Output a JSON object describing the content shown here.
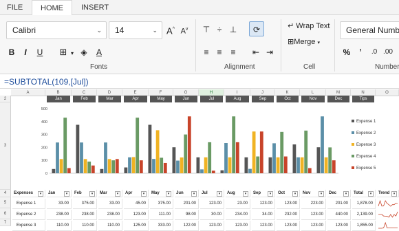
{
  "tabs": [
    "FILE",
    "HOME",
    "INSERT"
  ],
  "active_tab": "HOME",
  "font": {
    "name": "Calibri",
    "size": "14",
    "grow": "A",
    "shrink": "A"
  },
  "groups": {
    "fonts": "Fonts",
    "alignment": "Alignment",
    "cell": "Cell",
    "number": "Number"
  },
  "cell_group": {
    "wrap_text": "Wrap Text",
    "merge": "Merge"
  },
  "number_group": {
    "format": "General Number"
  },
  "formula": "=SUBTOTAL(109,[Jul])",
  "columns": [
    "A",
    "B",
    "C",
    "D",
    "E",
    "F",
    "G",
    "H",
    "I",
    "J",
    "K",
    "L",
    "M",
    "N",
    "O"
  ],
  "selected_column": "H",
  "rows": [
    "2",
    "3",
    "4",
    "5",
    "6",
    "7"
  ],
  "month_headers": [
    "Jan",
    "Feb",
    "Mar",
    "Apr",
    "May",
    "Jun",
    "Jul",
    "Aug",
    "Sep",
    "Oct",
    "Nov",
    "Dec",
    "Tips"
  ],
  "table": {
    "headers": [
      "Expenses",
      "Jan",
      "Feb",
      "Mar",
      "Apr",
      "May",
      "Jun",
      "Jul",
      "Aug",
      "Sep",
      "Oct",
      "Nov",
      "Dec",
      "Total",
      "Trend"
    ],
    "rows": [
      {
        "label": "Expense 1",
        "values": [
          "33.00",
          "375.00",
          "33.00",
          "45.00",
          "375.00",
          "201.00",
          "123.00",
          "23.00",
          "123.00",
          "123.00",
          "223.00",
          "201.00"
        ],
        "total": "1,878.00"
      },
      {
        "label": "Expense 2",
        "values": [
          "238.00",
          "238.00",
          "238.00",
          "123.00",
          "111.00",
          "98.00",
          "30.00",
          "234.00",
          "34.00",
          "232.00",
          "123.00",
          "440.00"
        ],
        "total": "2,139.00"
      },
      {
        "label": "Expense 3",
        "values": [
          "110.00",
          "110.00",
          "110.00",
          "125.00",
          "333.00",
          "122.00",
          "123.00",
          "123.00",
          "123.00",
          "123.00",
          "123.00",
          "123.00"
        ],
        "total": "1,855.00"
      }
    ]
  },
  "chart_data": {
    "type": "bar",
    "categories": [
      "Jan",
      "Feb",
      "Mar",
      "Apr",
      "May",
      "Jun",
      "Jul",
      "Aug",
      "Sep",
      "Oct",
      "Nov",
      "Dec"
    ],
    "ylim": [
      0,
      500
    ],
    "yticks": [
      "0",
      "100",
      "200",
      "300",
      "400",
      "500"
    ],
    "legend_position": "right",
    "series": [
      {
        "name": "Expense 1",
        "color": "#555555",
        "values": [
          33,
          375,
          33,
          45,
          375,
          201,
          123,
          23,
          123,
          123,
          223,
          201
        ]
      },
      {
        "name": "Expense 2",
        "color": "#5b8fa8",
        "values": [
          238,
          238,
          238,
          123,
          111,
          98,
          30,
          234,
          34,
          232,
          123,
          440
        ]
      },
      {
        "name": "Expense 3",
        "color": "#f0b323",
        "values": [
          110,
          110,
          110,
          125,
          333,
          122,
          123,
          123,
          323,
          123,
          123,
          123
        ]
      },
      {
        "name": "Expense 4",
        "color": "#6a9a64",
        "values": [
          430,
          90,
          100,
          430,
          120,
          300,
          240,
          440,
          130,
          320,
          330,
          200
        ]
      },
      {
        "name": "Expense 5",
        "color": "#c8442a",
        "values": [
          40,
          60,
          110,
          100,
          80,
          440,
          20,
          240,
          323,
          130,
          40,
          100
        ]
      }
    ]
  }
}
